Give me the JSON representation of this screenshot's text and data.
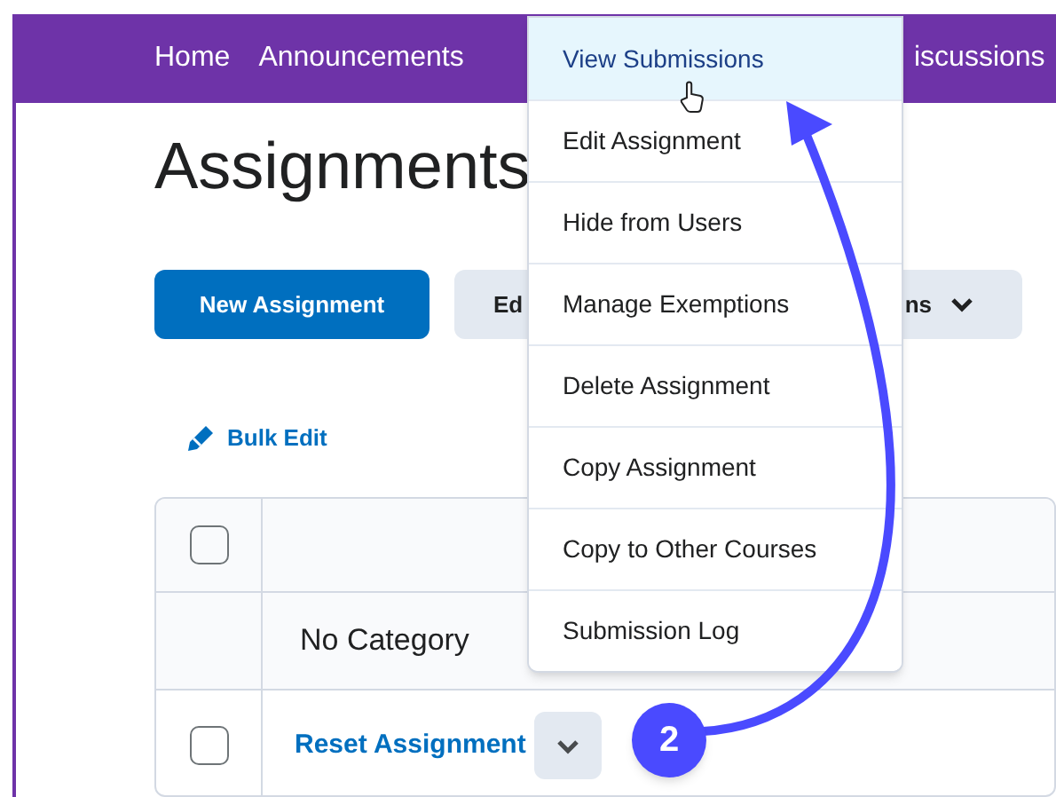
{
  "nav": {
    "items": [
      "Home",
      "Announcements",
      "iscussions"
    ]
  },
  "heading": "Assignments",
  "toolbar": {
    "primary_button": "New Assignment",
    "more_button": {
      "left_text": "Ed",
      "right_text": "ns"
    }
  },
  "bulk_edit": "Bulk Edit",
  "table": {
    "header_checked": false,
    "category": "No Category",
    "rows": [
      {
        "title": "Reset Assignment",
        "checked": false
      }
    ]
  },
  "context_menu": {
    "items": [
      {
        "label": "View Submissions",
        "selected": true
      },
      {
        "label": "Edit Assignment",
        "selected": false
      },
      {
        "label": "Hide from Users",
        "selected": false
      },
      {
        "label": "Manage Exemptions",
        "selected": false
      },
      {
        "label": "Delete Assignment",
        "selected": false
      },
      {
        "label": "Copy Assignment",
        "selected": false
      },
      {
        "label": "Copy to Other Courses",
        "selected": false
      },
      {
        "label": "Submission Log",
        "selected": false
      }
    ]
  },
  "callout": {
    "number": "2"
  }
}
